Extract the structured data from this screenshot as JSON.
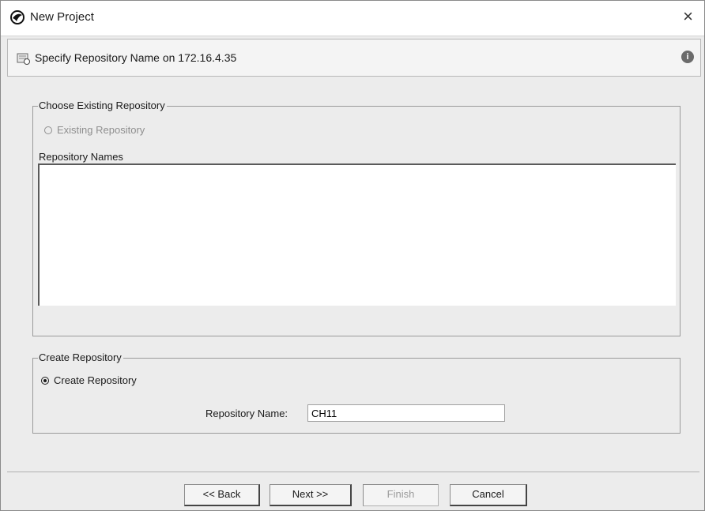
{
  "window": {
    "title": "New Project",
    "close_glyph": "×",
    "icons": {
      "app": "app-logo-icon",
      "close": "close-icon"
    }
  },
  "header": {
    "text": "Specify Repository Name on 172.16.4.35",
    "icons": {
      "left": "repository-icon",
      "right": "info-icon"
    },
    "info_glyph": "i"
  },
  "existing": {
    "group_label": "Choose Existing Repository",
    "radio_label": "Existing Repository",
    "radio_selected": false,
    "radio_enabled": false,
    "list_label": "Repository Names",
    "items": []
  },
  "create": {
    "group_label": "Create Repository",
    "radio_label": "Create Repository",
    "radio_selected": true,
    "name_label": "Repository Name:",
    "name_value": "CH11"
  },
  "buttons": {
    "back": "<< Back",
    "next": "Next >>",
    "finish": "Finish",
    "cancel": "Cancel"
  }
}
